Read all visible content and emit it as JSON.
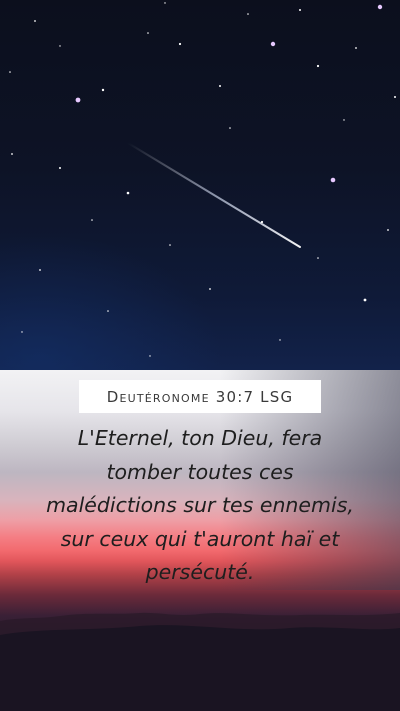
{
  "reference": "Deutéronome 30:7 LSG",
  "verse": "L'Eternel, ton Dieu, fera tomber toutes ces malédictions sur tes ennemis, sur ceux qui t'auront haï et persécuté.",
  "colors": {
    "sky_top": "#0c0f1d",
    "sky_bottom": "#12224a",
    "band_top": "#f2f2f4",
    "sunset_red": "#f26a6e",
    "ground": "#14121e",
    "reference_box": "#ffffff",
    "text": "#1e1e1e"
  }
}
